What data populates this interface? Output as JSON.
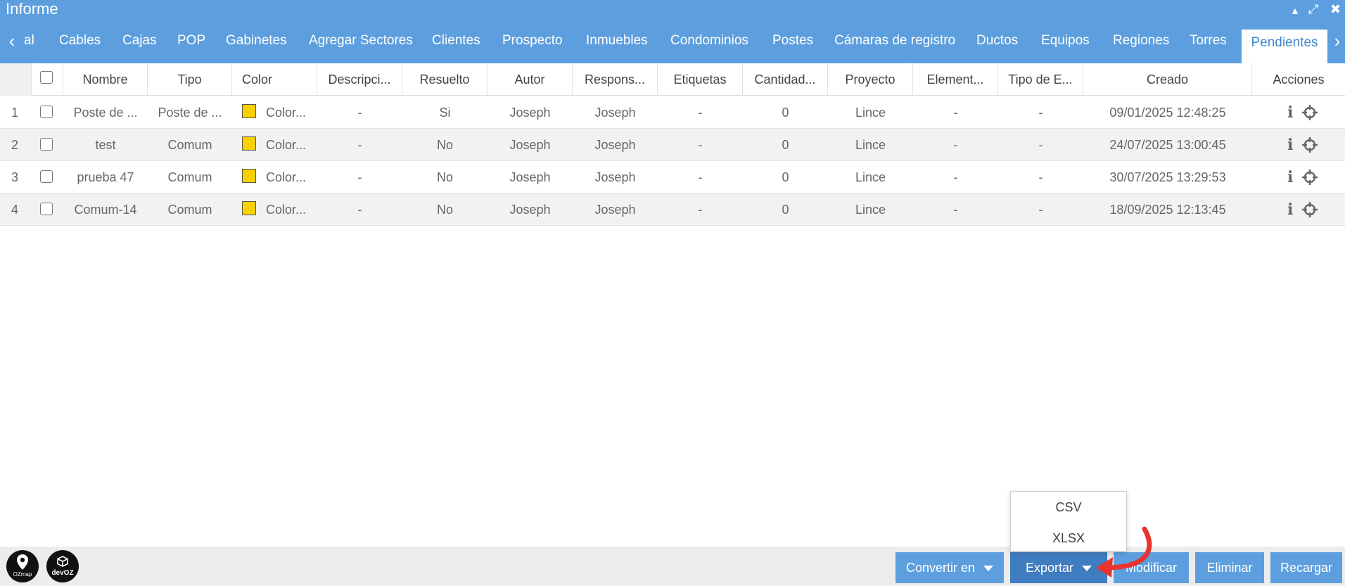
{
  "window": {
    "title": "Informe",
    "controls": {
      "collapse": "▲",
      "maximize": "⤢",
      "close": "✖"
    }
  },
  "tabs": {
    "prev_icon": "‹",
    "next_icon": "›",
    "items": [
      "al",
      "Cables",
      "Cajas",
      "POP",
      "Gabinetes",
      "Agregar Sectores",
      "Clientes",
      "Prospecto",
      "Inmuebles",
      "Condominios",
      "Postes",
      "Cámaras de registro",
      "Ductos",
      "Equipos",
      "Regiones",
      "Torres",
      "Pendientes"
    ],
    "active": "Pendientes"
  },
  "table": {
    "headers": [
      "Nombre",
      "Tipo",
      "Color",
      "Descripci...",
      "Resuelto",
      "Autor",
      "Respons...",
      "Etiquetas",
      "Cantidad...",
      "Proyecto",
      "Element...",
      "Tipo de E...",
      "Creado",
      "Acciones"
    ],
    "rows": [
      {
        "num": "1",
        "nombre": "Poste de ...",
        "tipo": "Poste de ...",
        "color": "Color...",
        "descripcion": "-",
        "resuelto": "Si",
        "autor": "Joseph",
        "responsable": "Joseph",
        "etiquetas": "-",
        "cantidad": "0",
        "proyecto": "Lince",
        "elemento": "-",
        "tipo_elemento": "-",
        "creado": "09/01/2025 12:48:25"
      },
      {
        "num": "2",
        "nombre": "test",
        "tipo": "Comum",
        "color": "Color...",
        "descripcion": "-",
        "resuelto": "No",
        "autor": "Joseph",
        "responsable": "Joseph",
        "etiquetas": "-",
        "cantidad": "0",
        "proyecto": "Lince",
        "elemento": "-",
        "tipo_elemento": "-",
        "creado": "24/07/2025 13:00:45"
      },
      {
        "num": "3",
        "nombre": "prueba 47",
        "tipo": "Comum",
        "color": "Color...",
        "descripcion": "-",
        "resuelto": "No",
        "autor": "Joseph",
        "responsable": "Joseph",
        "etiquetas": "-",
        "cantidad": "0",
        "proyecto": "Lince",
        "elemento": "-",
        "tipo_elemento": "-",
        "creado": "30/07/2025 13:29:53"
      },
      {
        "num": "4",
        "nombre": "Comum-14",
        "tipo": "Comum",
        "color": "Color...",
        "descripcion": "-",
        "resuelto": "No",
        "autor": "Joseph",
        "responsable": "Joseph",
        "etiquetas": "-",
        "cantidad": "0",
        "proyecto": "Lince",
        "elemento": "-",
        "tipo_elemento": "-",
        "creado": "18/09/2025 12:13:45"
      }
    ],
    "swatch_color": "#f7d200"
  },
  "footer": {
    "logos": {
      "ozmap": "OZmap",
      "devoz": "devOZ"
    },
    "buttons": {
      "convert": "Convertir en",
      "export": "Exportar",
      "modify": "Modificar",
      "delete": "Eliminar",
      "reload": "Recargar"
    },
    "export_menu": [
      "CSV",
      "XLSX"
    ]
  },
  "colors": {
    "primary": "#5d9fde",
    "primary_dark": "#3f7cc0",
    "annotation_arrow": "#e8332f"
  }
}
